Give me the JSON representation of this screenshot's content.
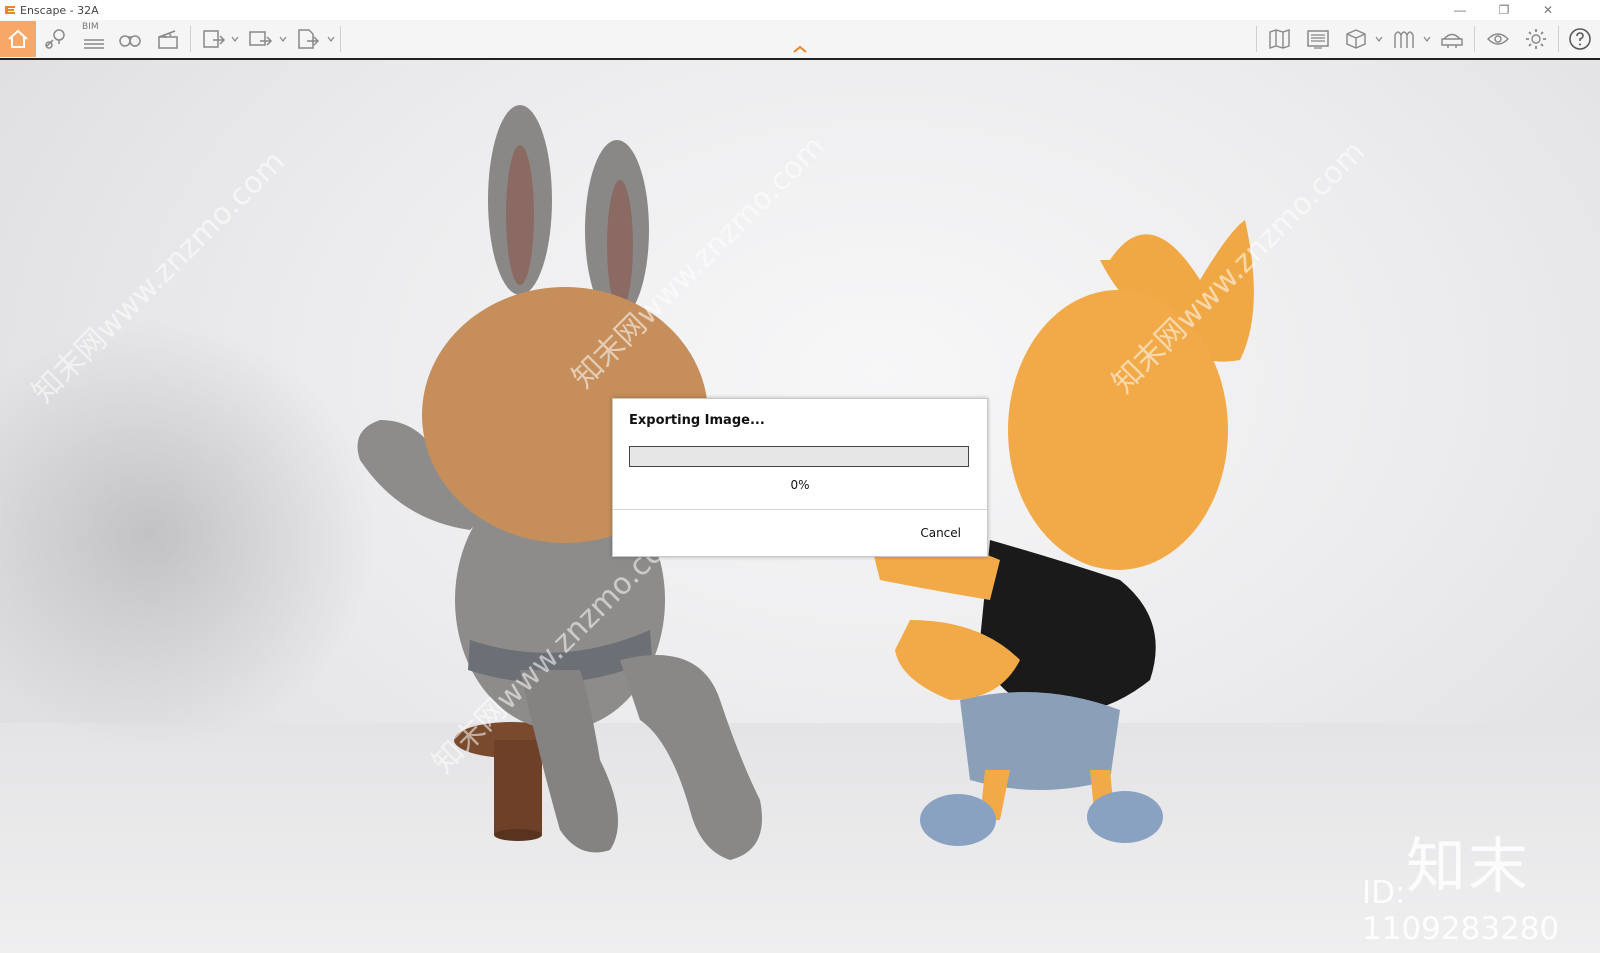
{
  "window": {
    "title": "Enscape - 32A",
    "controls": {
      "minimize": "—",
      "restore": "❐",
      "close": "✕"
    }
  },
  "toolbar": {
    "bim_label": "BIM",
    "left_icons": [
      "home-icon",
      "location-pin-icon",
      "bim-icon",
      "binoculars-icon",
      "clapperboard-icon",
      "image-export-icon",
      "panorama-export-icon",
      "exe-export-icon"
    ],
    "right_icons": [
      "map-icon",
      "screen-icon",
      "cube-icon",
      "asset-icon",
      "hat-icon",
      "eye-icon",
      "gear-icon",
      "help-icon"
    ],
    "accent_color": "#f7a869"
  },
  "dialog": {
    "title": "Exporting Image...",
    "progress": 0,
    "progress_text": "0%",
    "cancel_label": "Cancel"
  },
  "watermark": {
    "text": "知末网www.znzmo.com",
    "brand": "知末",
    "id": "ID: 1109283280"
  }
}
